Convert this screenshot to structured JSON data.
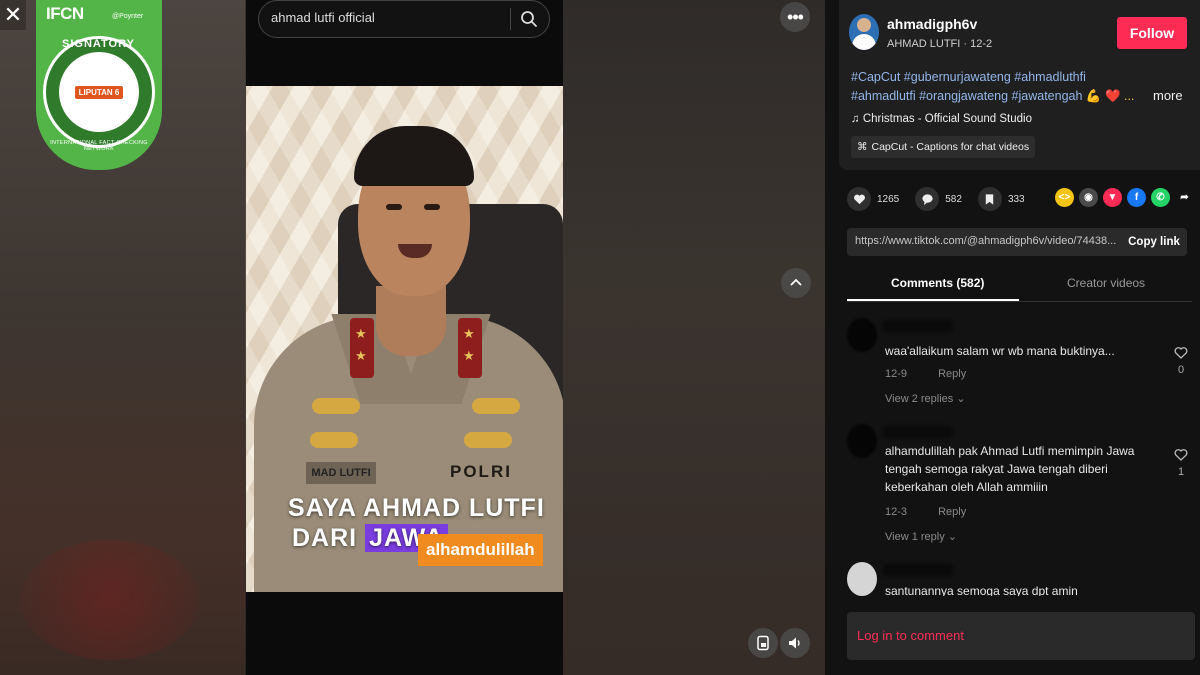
{
  "window": {
    "close_label": "✕"
  },
  "badge": {
    "org": "IFCN",
    "sponsor": "@Poynter",
    "title": "SIGNATORY",
    "network": "INTERNATIONAL FACT-CHECKING NETWORK",
    "member": "LIPUTAN 6"
  },
  "search": {
    "query": "ahmad lutfi official"
  },
  "video": {
    "caption_line1": "SAYA AHMAD LUTFI",
    "caption_line2_prefix": "DARI",
    "caption_line2_highlight": "JAWA",
    "caption_tag": "alhamdulillah",
    "name_tag": "MAD LUTFI",
    "uniform_text": "POLRI"
  },
  "controls": {
    "more_label": "•••",
    "up_label": "⌃"
  },
  "post": {
    "username": "ahmadigph6v",
    "subtitle": "AHMAD LUTFI · 12-2",
    "follow_label": "Follow",
    "hashtags": "#CapCut #gubernurjawateng #ahmadluthfi #ahmadlutfi #orangjawateng #jawatengah",
    "hashtags_emoji": "💪 ❤️ ...",
    "more_label": "more",
    "sound": "Christmas - Official Sound Studio",
    "capcut": "CapCut - Captions for chat videos"
  },
  "stats": {
    "likes": "1265",
    "comments": "582",
    "saves": "333"
  },
  "share": {
    "url": "https://www.tiktok.com/@ahmadigph6v/video/74438...",
    "copy_label": "Copy link",
    "colors": {
      "embed": "#f3c316",
      "friends": "#4a4a4a",
      "send": "#fe2c55",
      "facebook": "#1877f2",
      "whatsapp": "#25d366"
    }
  },
  "tabs": {
    "comments": "Comments (582)",
    "creator": "Creator videos"
  },
  "comments": [
    {
      "text": "waa'allaikum salam wr wb mana buktinya...",
      "date": "12-9",
      "reply_label": "Reply",
      "replies": "View 2 replies ⌄",
      "likes": "0"
    },
    {
      "text": "alhamdulillah pak Ahmad Lutfi memimpin Jawa tengah semoga rakyat Jawa tengah diberi keberkahan oleh Allah ammiiin",
      "date": "12-3",
      "reply_label": "Reply",
      "replies": "View 1 reply ⌄",
      "likes": "1"
    },
    {
      "text": "santunannya semoga saya dpt amin"
    }
  ],
  "login": {
    "label": "Log in to comment"
  },
  "colors": {
    "accent": "#fe2c55",
    "hashtag": "#93b6ea",
    "background": "#121212"
  }
}
